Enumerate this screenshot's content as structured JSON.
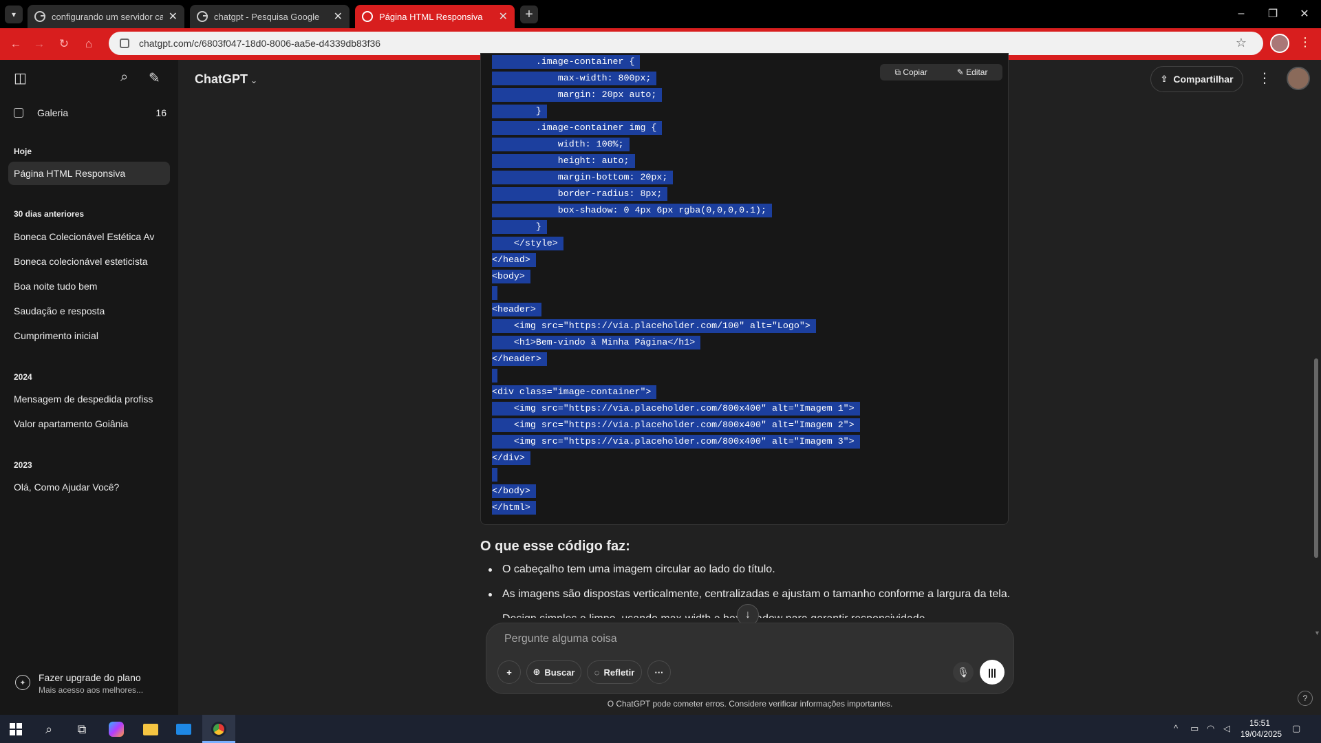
{
  "browser": {
    "tabs": [
      {
        "title": "configurando um servidor case",
        "active": false
      },
      {
        "title": "chatgpt - Pesquisa Google",
        "active": false
      },
      {
        "title": "Página HTML Responsiva",
        "active": true
      }
    ],
    "url": "chatgpt.com/c/6803f047-18d0-8006-aa5e-d4339db83f36",
    "accent_color": "#d81e1e"
  },
  "sidebar": {
    "gallery_label": "Galeria",
    "gallery_count": "16",
    "sections": [
      {
        "label": "Hoje",
        "items": [
          "Página HTML Responsiva"
        ]
      },
      {
        "label": "30 dias anteriores",
        "items": [
          "Boneca Colecionável Estética Av",
          "Boneca colecionável esteticista",
          "Boa noite tudo bem",
          "Saudação e resposta",
          "Cumprimento inicial"
        ]
      },
      {
        "label": "2024",
        "items": [
          "Mensagem de despedida profiss",
          "Valor apartamento Goiânia"
        ]
      },
      {
        "label": "2023",
        "items": [
          "Olá, Como Ajudar Você?"
        ]
      }
    ],
    "upgrade_title": "Fazer upgrade do plano",
    "upgrade_sub": "Mais acesso aos melhores..."
  },
  "header": {
    "model": "ChatGPT",
    "share_label": "Compartilhar"
  },
  "code": {
    "copy_label": "Copiar",
    "edit_label": "Editar",
    "lines": [
      "        .image-container {",
      "            max-width: 800px;",
      "            margin: 20px auto;",
      "        }",
      "        .image-container img {",
      "            width: 100%;",
      "            height: auto;",
      "            margin-bottom: 20px;",
      "            border-radius: 8px;",
      "            box-shadow: 0 4px 6px rgba(0,0,0,0.1);",
      "        }",
      "    </style>",
      "</head>",
      "<body>",
      "",
      "<header>",
      "    <img src=\"https://via.placeholder.com/100\" alt=\"Logo\">",
      "    <h1>Bem-vindo à Minha Página</h1>",
      "</header>",
      "",
      "<div class=\"image-container\">",
      "    <img src=\"https://via.placeholder.com/800x400\" alt=\"Imagem 1\">",
      "    <img src=\"https://via.placeholder.com/800x400\" alt=\"Imagem 2\">",
      "    <img src=\"https://via.placeholder.com/800x400\" alt=\"Imagem 3\">",
      "</div>",
      "",
      "</body>",
      "</html>"
    ]
  },
  "answer": {
    "heading": "O que esse código faz:",
    "bullets": [
      "O cabeçalho tem uma imagem circular ao lado do título.",
      "As imagens são dispostas verticalmente, centralizadas e ajustam o tamanho conforme a largura da tela.",
      "Design simples e limpo, usando max-width e box-shadow para garantir responsividade."
    ]
  },
  "composer": {
    "placeholder": "Pergunte alguma coisa",
    "search_label": "Buscar",
    "think_label": "Refletir"
  },
  "disclaimer": "O ChatGPT pode cometer erros. Considere verificar informações importantes.",
  "taskbar": {
    "time": "15:51",
    "date": "19/04/2025"
  }
}
